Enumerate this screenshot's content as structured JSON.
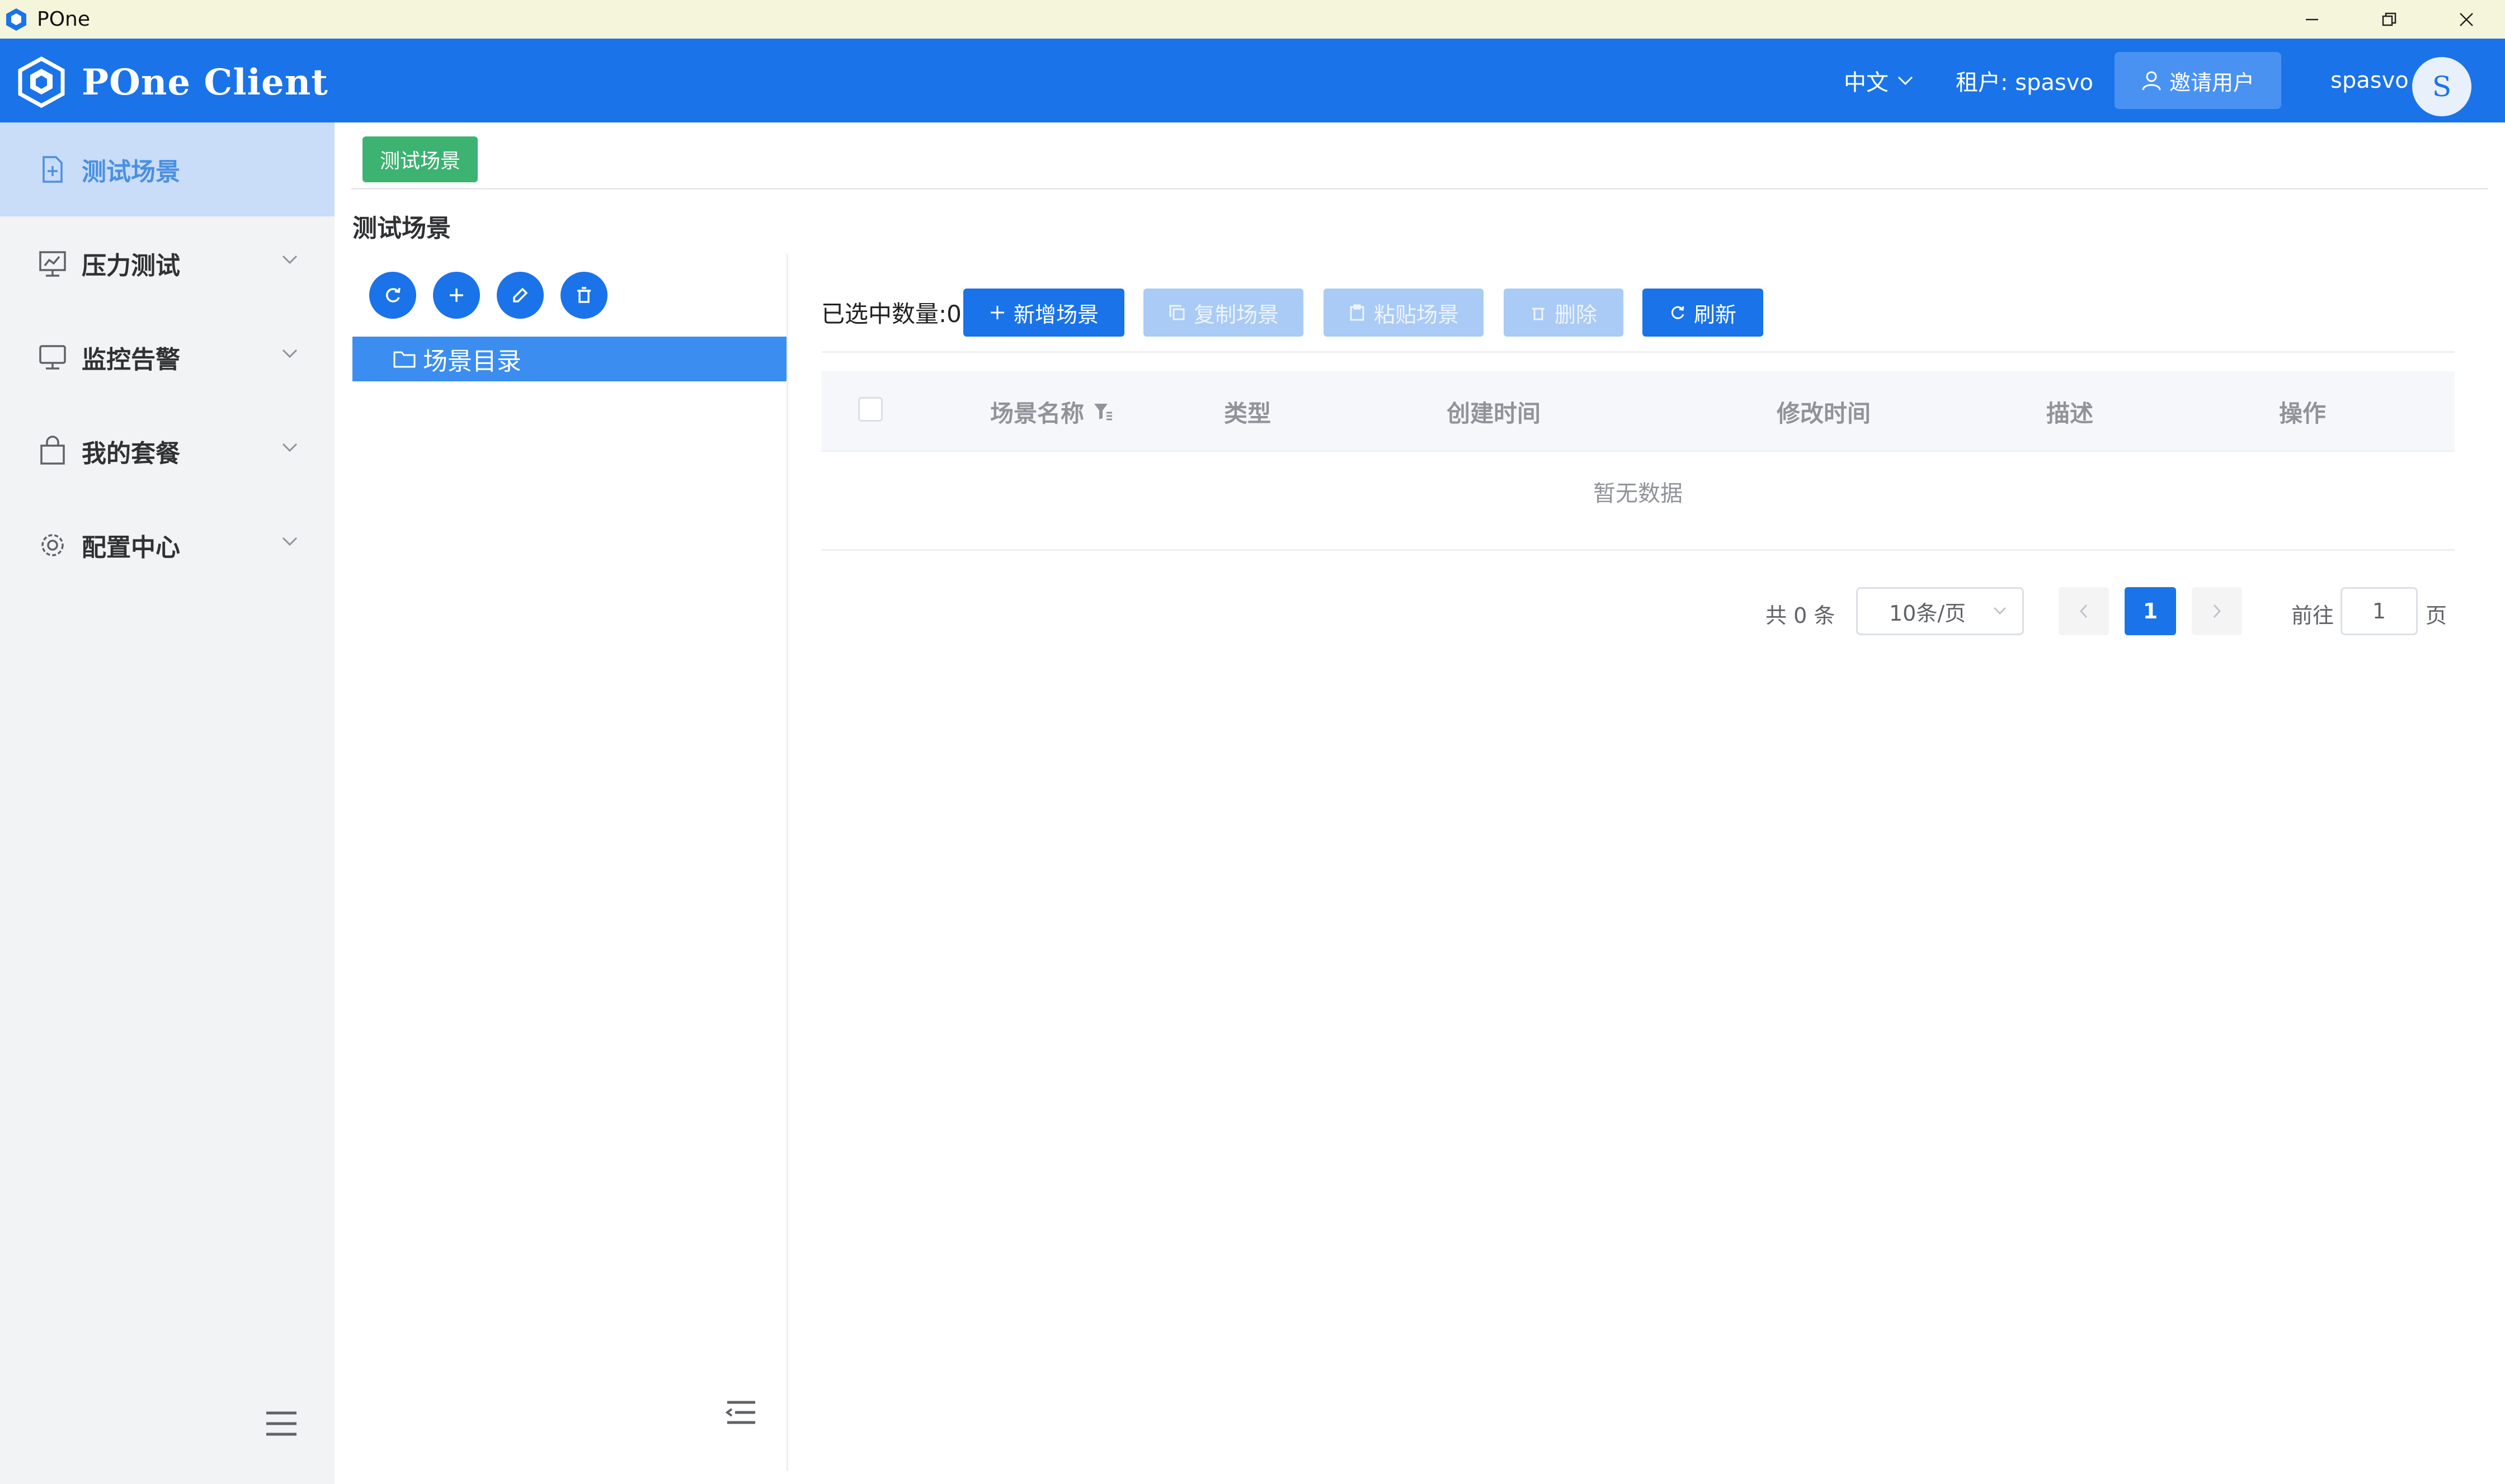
{
  "window": {
    "title": "POne"
  },
  "header": {
    "brand": "POne Client",
    "language": "中文",
    "tenant": "租户: spasvo",
    "invite_label": "邀请用户",
    "username": "spasvo",
    "avatar_initial": "S",
    "accent_color": "#1a73e8"
  },
  "sidebar": {
    "items": [
      {
        "label": "测试场景",
        "icon": "scene-doc-icon",
        "active": true
      },
      {
        "label": "压力测试",
        "icon": "chart-board-icon"
      },
      {
        "label": "监控告警",
        "icon": "monitor-icon"
      },
      {
        "label": "我的套餐",
        "icon": "bag-icon"
      },
      {
        "label": "配置中心",
        "icon": "gear-icon"
      }
    ]
  },
  "tabs": [
    {
      "label": "测试场景",
      "color": "#3cb371"
    }
  ],
  "page": {
    "title": "测试场景"
  },
  "tree": {
    "tools": [
      "refresh-icon",
      "plus-icon",
      "edit-icon",
      "trash-icon"
    ],
    "nodes": [
      {
        "label": "场景目录",
        "selected": true
      }
    ]
  },
  "toolbar": {
    "selected_count": "已选中数量:0",
    "add": "新增场景",
    "copy": "复制场景",
    "paste": "粘贴场景",
    "delete": "删除",
    "refresh": "刷新"
  },
  "table": {
    "columns": [
      "场景名称",
      "类型",
      "创建时间",
      "修改时间",
      "描述",
      "操作"
    ],
    "rows": [],
    "empty_text": "暂无数据"
  },
  "pagination": {
    "total": "共 0 条",
    "page_size": "10条/页",
    "current_page": "1",
    "goto_label": "前往",
    "goto_value": "1",
    "page_suffix": "页"
  }
}
